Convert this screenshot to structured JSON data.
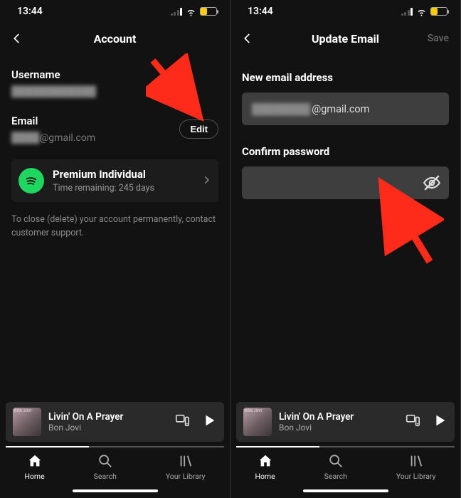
{
  "status": {
    "time": "13:44"
  },
  "left": {
    "title": "Account",
    "username_label": "Username",
    "username_value": "████████████",
    "email_label": "Email",
    "email_value": "████@gmail.com",
    "edit_label": "Edit",
    "plan_title": "Premium Individual",
    "plan_sub": "Time remaining: 245 days",
    "hint": "To close (delete) your account permanently, contact customer support."
  },
  "right": {
    "title": "Update Email",
    "save_label": "Save",
    "new_email_label": "New email address",
    "new_email_value": "████████@gmail.com",
    "confirm_pwd_label": "Confirm password"
  },
  "now_playing": {
    "title": "Livin' On A Prayer",
    "artist": "Bon Jovi"
  },
  "nav": {
    "home": "Home",
    "search": "Search",
    "library": "Your Library"
  }
}
